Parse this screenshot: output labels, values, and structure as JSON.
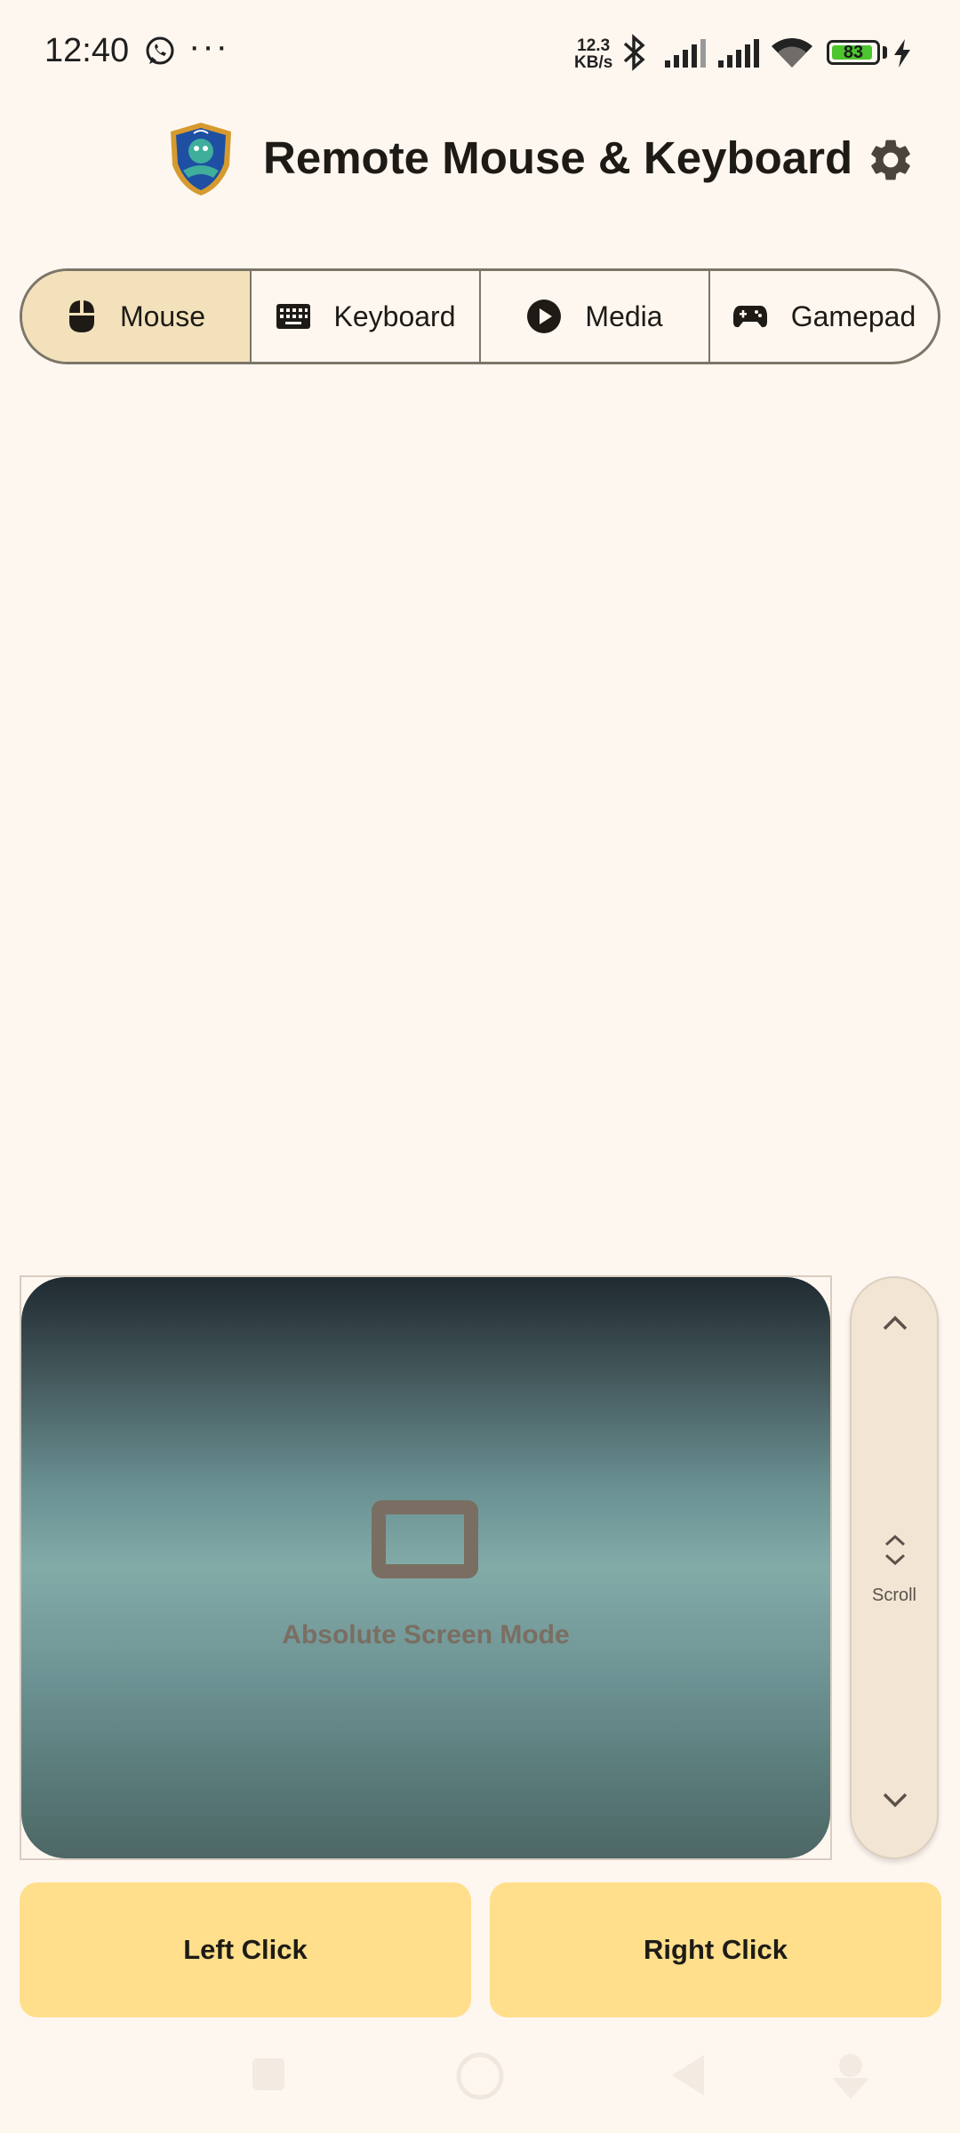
{
  "status_bar": {
    "time": "12:40",
    "more": "···",
    "net_speed_value": "12.3",
    "net_speed_unit": "KB/s",
    "battery_level": "83",
    "icons": [
      "whatsapp-icon",
      "bluetooth-icon",
      "signal-icon",
      "signal-icon",
      "wifi-icon",
      "battery-icon",
      "charging-icon"
    ]
  },
  "app_bar": {
    "title": "Remote Mouse & Keyboard",
    "icons": [
      "app-logo",
      "settings-icon"
    ]
  },
  "tabs": [
    {
      "label": "Mouse",
      "icon": "mouse-icon",
      "selected": true
    },
    {
      "label": "Keyboard",
      "icon": "keyboard-icon",
      "selected": false
    },
    {
      "label": "Media",
      "icon": "play-icon",
      "selected": false
    },
    {
      "label": "Gamepad",
      "icon": "gamepad-icon",
      "selected": false
    }
  ],
  "touchpad": {
    "mode_label": "Absolute Screen Mode",
    "icon": "screen-icon"
  },
  "scroll": {
    "label": "Scroll",
    "icons": [
      "chevron-up-icon",
      "unfold-icon",
      "chevron-down-icon"
    ]
  },
  "buttons": {
    "left_click": "Left Click",
    "right_click": "Right Click"
  },
  "nav_bar": {
    "icons": [
      "recents-icon",
      "home-icon",
      "back-icon",
      "assistant-icon"
    ]
  },
  "colors": {
    "background": "#FEF7F0",
    "selected_tab": "#F2E1BB",
    "click_button": "#FFDF8C",
    "scroll_strip": "#F2E5D4"
  }
}
